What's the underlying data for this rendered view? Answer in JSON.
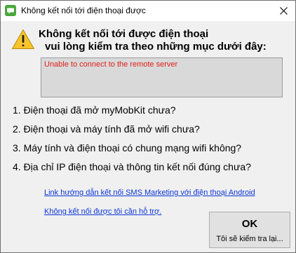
{
  "window": {
    "title": "Không kết nối tới điện thoại được",
    "app_icon": "chat-bubble-icon",
    "close_icon": "close-icon"
  },
  "message": {
    "icon": "warning-icon",
    "heading_line1": "Không kết nối tới được điện thoại",
    "heading_line2": "vui lòng kiểm tra theo những mục dưới đây:",
    "error_text": "Unable to connect to the remote server",
    "error_color": "#e0201b"
  },
  "checklist": [
    "1. Điện thoại đã mở myMobKit chưa?",
    "2. Điện thoại và máy tính đã mở wifi chưa?",
    "3. Máy tính và điện thoại có chung mạng wifi không?",
    "4. Địa chỉ IP điện thoại và thông tin kết nối đúng chưa?"
  ],
  "links": {
    "guide": "Link hướng dẫn kết nối SMS Marketing với điện thoại Android",
    "support": "Không kết nối được tôi cần hỗ trợ.",
    "color": "#0b36d8"
  },
  "ok_button": {
    "label": "OK",
    "sublabel": "Tôi sẽ kiểm tra lại..."
  }
}
